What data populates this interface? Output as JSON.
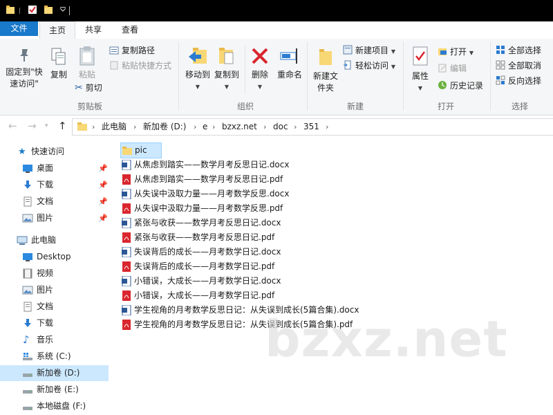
{
  "ribbon_tabs": {
    "file": "文件",
    "home": "主页",
    "share": "共享",
    "view": "查看"
  },
  "clipboard": {
    "pin": "固定到\"快速访问\"",
    "copy": "复制",
    "paste": "粘贴",
    "copy_path": "复制路径",
    "paste_shortcut": "粘贴快捷方式",
    "cut": "剪切",
    "group": "剪贴板"
  },
  "organize": {
    "move_to": "移动到",
    "copy_to": "复制到",
    "delete": "删除",
    "rename": "重命名",
    "group": "组织"
  },
  "new_group": {
    "new_folder": "新建文件夹",
    "new_item": "新建项目",
    "easy_access": "轻松访问",
    "group": "新建"
  },
  "open_group": {
    "properties": "属性",
    "open": "打开",
    "edit": "编辑",
    "history": "历史记录",
    "group": "打开"
  },
  "select_group": {
    "select_all": "全部选择",
    "select_none": "全部取消",
    "invert": "反向选择",
    "group": "选择"
  },
  "address": {
    "crumbs": [
      "此电脑",
      "新加卷 (D:)",
      "e",
      "bzxz.net",
      "doc",
      "351"
    ]
  },
  "nav": {
    "quick_access": "快速访问",
    "quick_items": [
      "桌面",
      "下载",
      "文档",
      "图片"
    ],
    "this_pc": "此电脑",
    "pc_items": [
      "Desktop",
      "视频",
      "图片",
      "文档",
      "下载",
      "音乐",
      "系统 (C:)",
      "新加卷 (D:)",
      "新加卷 (E:)",
      "本地磁盘 (F:)"
    ]
  },
  "files": [
    {
      "name": "pic",
      "type": "folder"
    },
    {
      "name": "从焦虑到踏实——数学月考反思日记.docx",
      "type": "docx"
    },
    {
      "name": "从焦虑到踏实——数学月考反思日记.pdf",
      "type": "pdf"
    },
    {
      "name": "从失误中汲取力量——月考数学反思.docx",
      "type": "docx"
    },
    {
      "name": "从失误中汲取力量——月考数学反思.pdf",
      "type": "pdf"
    },
    {
      "name": "紧张与收获——数学月考反思日记.docx",
      "type": "docx"
    },
    {
      "name": "紧张与收获——数学月考反思日记.pdf",
      "type": "pdf"
    },
    {
      "name": "失误背后的成长——月考数学日记.docx",
      "type": "docx"
    },
    {
      "name": "失误背后的成长——月考数学日记.pdf",
      "type": "pdf"
    },
    {
      "name": "小错误，大成长——月考数学日记.docx",
      "type": "docx"
    },
    {
      "name": "小错误，大成长——月考数学日记.pdf",
      "type": "pdf"
    },
    {
      "name": "学生视角的月考数学反思日记：从失误到成长(5篇合集).docx",
      "type": "docx"
    },
    {
      "name": "学生视角的月考数学反思日记：从失误到成长(5篇合集).pdf",
      "type": "pdf"
    }
  ],
  "watermark": "bzxz.net",
  "colors": {
    "accent": "#1979ca",
    "selection": "#cce8ff",
    "folder": "#f8d775",
    "pdf": "#d9262e",
    "word": "#2b5797"
  }
}
